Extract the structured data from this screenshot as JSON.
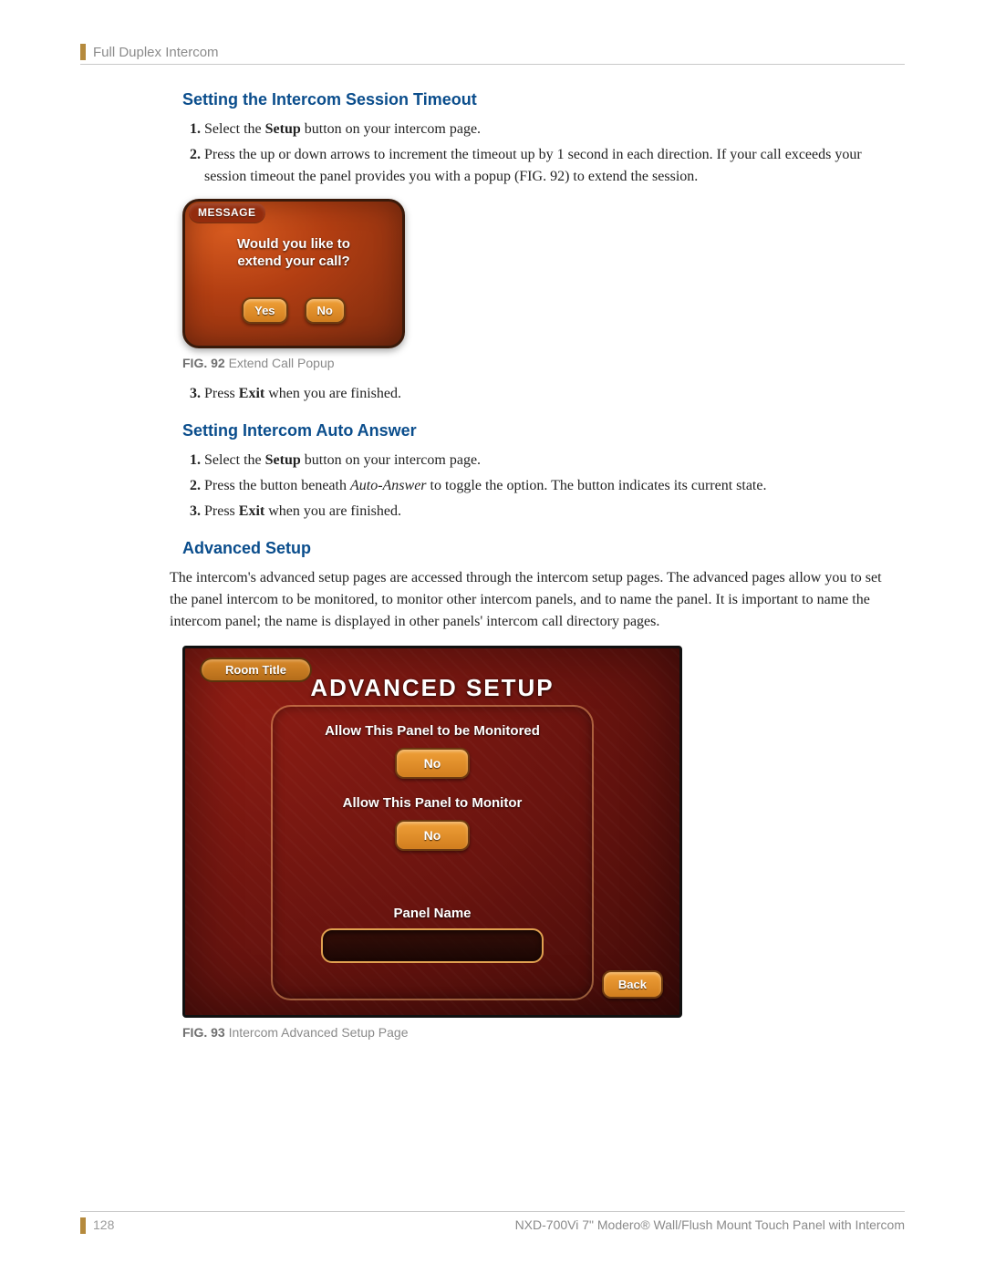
{
  "header": {
    "section": "Full Duplex Intercom"
  },
  "sectionA": {
    "title": "Setting the Intercom Session Timeout",
    "step1_pre": "Select the ",
    "step1_bold": "Setup",
    "step1_post": " button on your intercom page.",
    "step2": "Press the up or down arrows to increment the timeout up by 1 second in each direction. If your call exceeds your session timeout the panel provides you with a popup (FIG. 92) to extend the session."
  },
  "fig92": {
    "title": "MESSAGE",
    "line1": "Would you like to",
    "line2": "extend your call?",
    "yes": "Yes",
    "no": "No",
    "caption_bold": "FIG. 92",
    "caption_text": "  Extend Call Popup"
  },
  "sectionA_step3_pre": "Press ",
  "sectionA_step3_bold": "Exit",
  "sectionA_step3_post": " when you are finished.",
  "sectionB": {
    "title": "Setting Intercom Auto Answer",
    "step1_pre": "Select the ",
    "step1_bold": "Setup",
    "step1_post": " button on your intercom page.",
    "step2_pre": "Press the button beneath ",
    "step2_ital": "Auto-Answer",
    "step2_post": " to toggle the option. The button indicates its current state.",
    "step3_pre": "Press ",
    "step3_bold": "Exit",
    "step3_post": " when you are finished."
  },
  "sectionC": {
    "title": "Advanced Setup",
    "para": "The intercom's advanced setup pages are accessed through the intercom setup pages. The advanced pages allow you to set the panel intercom to be monitored, to monitor other intercom panels, and to name the panel. It is important to name the intercom panel; the name is displayed in other panels' intercom call directory pages."
  },
  "fig93": {
    "room": "Room Title",
    "title": "ADVANCED SETUP",
    "label1": "Allow This Panel to be Monitored",
    "btn1": "No",
    "label2": "Allow This Panel to Monitor",
    "btn2": "No",
    "label3": "Panel Name",
    "panel_name_value": "",
    "back": "Back",
    "caption_bold": "FIG. 93",
    "caption_text": "  Intercom Advanced Setup Page"
  },
  "footer": {
    "page": "128",
    "title": "NXD-700Vi 7\" Modero® Wall/Flush Mount Touch Panel with Intercom"
  }
}
